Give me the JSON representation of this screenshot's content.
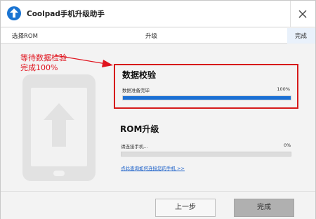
{
  "window": {
    "title": "Coolpad手机升级助手",
    "close_icon": "close-icon"
  },
  "steps": [
    {
      "label": "选择ROM"
    },
    {
      "label": "升级"
    },
    {
      "label": "完成"
    }
  ],
  "annotation": {
    "line1": "等待数据检验",
    "line2": "完成100%",
    "color": "#e0141e"
  },
  "verify": {
    "title": "数据校验",
    "status": "数据准备完毕",
    "percent_text": "100%",
    "progress": 1.0
  },
  "rom": {
    "title": "ROM升级",
    "status": "请连接手机...",
    "percent_text": "0%",
    "progress": 0.0,
    "help_link": "点此查询如何连接您的手机 >>"
  },
  "buttons": {
    "prev": "上一步",
    "done": "完成"
  },
  "colors": {
    "accent": "#1a6fd4",
    "highlight_border": "#d61a1a"
  }
}
